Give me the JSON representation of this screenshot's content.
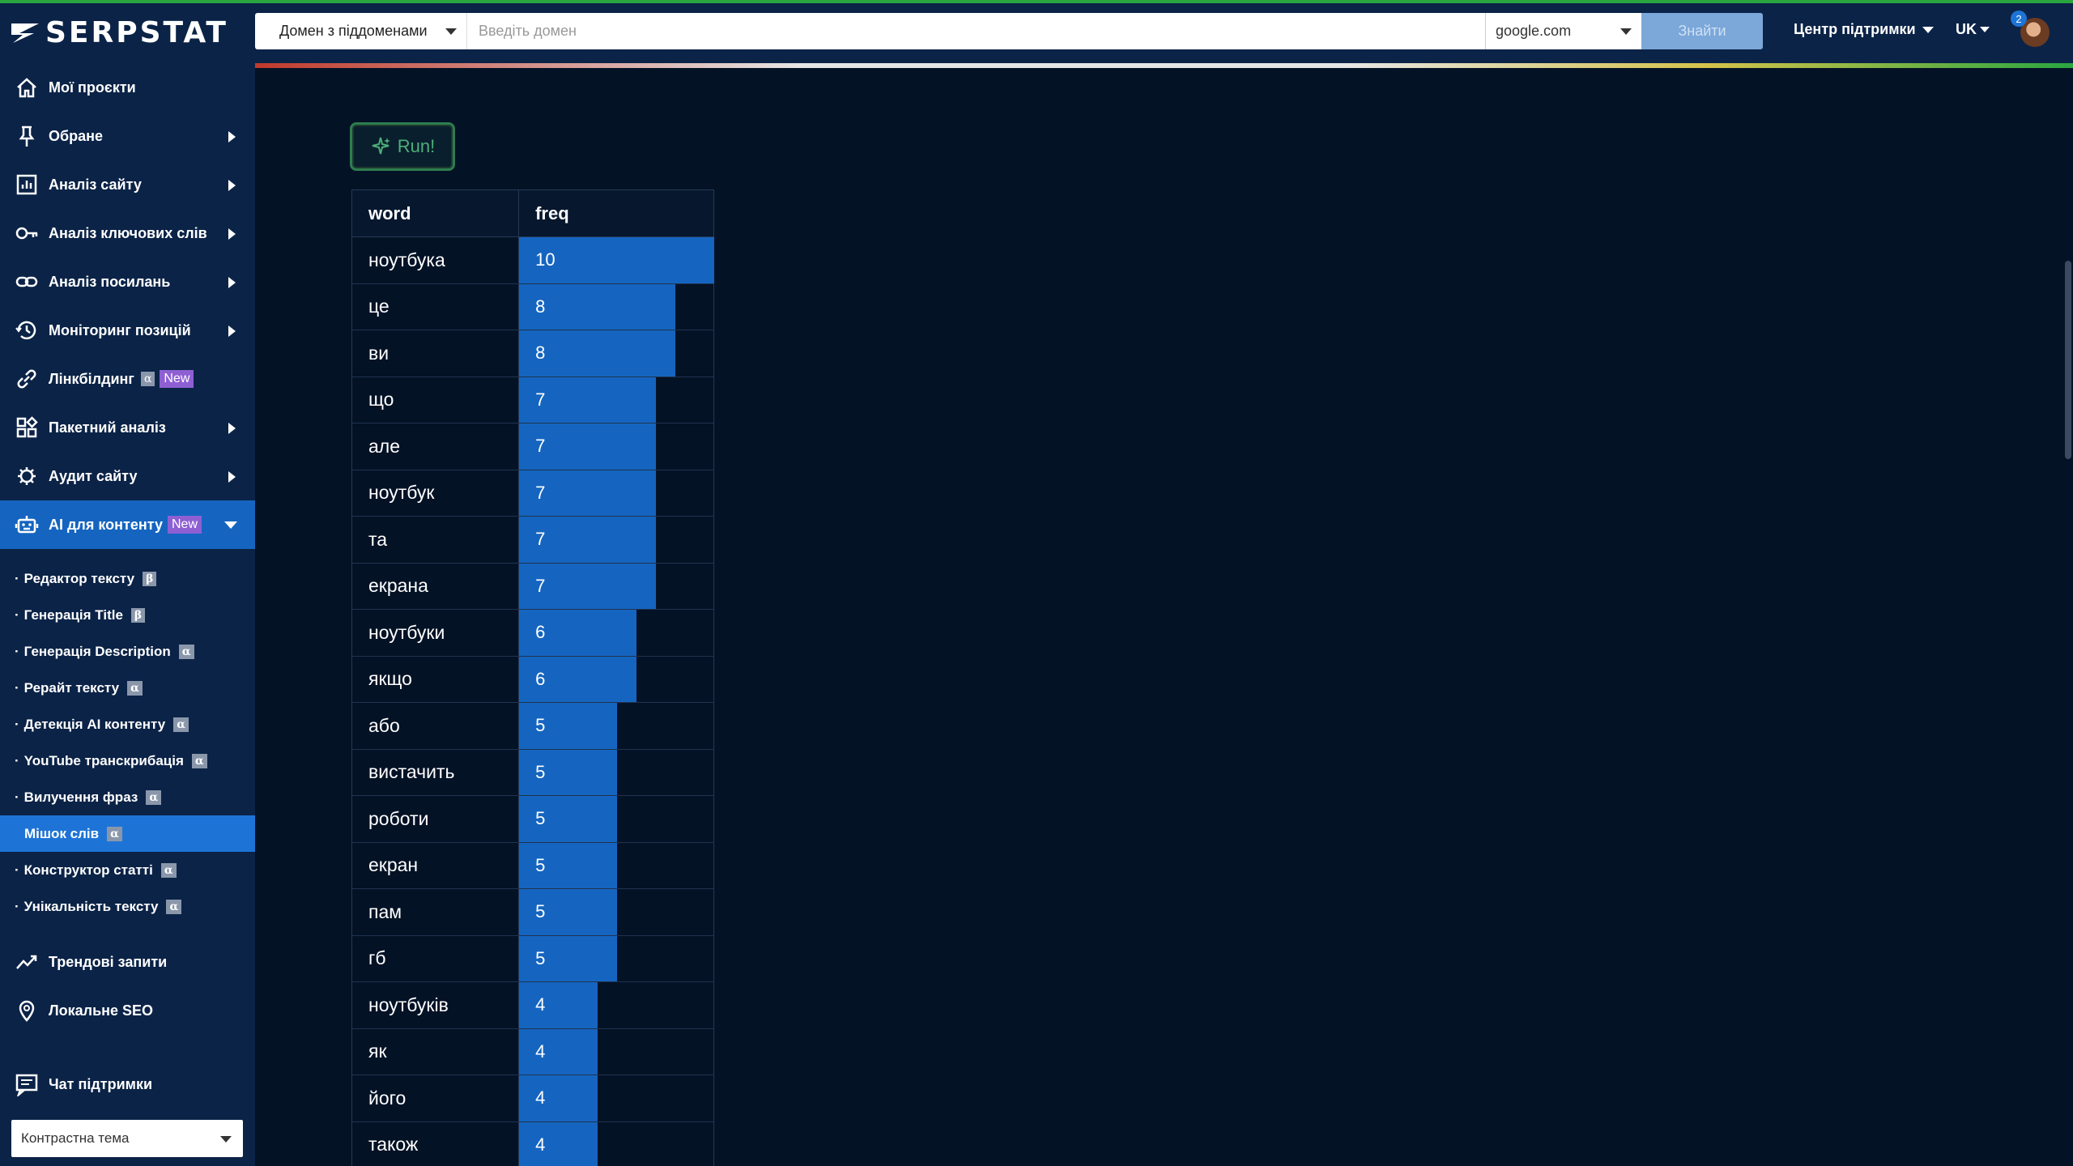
{
  "brand": {
    "name": "SERPSTAT"
  },
  "sidebar": {
    "items": [
      {
        "label": "Мої проєкти",
        "icon": "home-icon",
        "arrow": false
      },
      {
        "label": "Обране",
        "icon": "pin-icon",
        "arrow": true
      },
      {
        "label": "Аналіз сайту",
        "icon": "site-analysis-icon",
        "arrow": true
      },
      {
        "label": "Аналіз ключових слів",
        "icon": "key-icon",
        "arrow": true
      },
      {
        "label": "Аналіз посилань",
        "icon": "link-icon",
        "arrow": true
      },
      {
        "label": "Моніторинг позицій",
        "icon": "history-icon",
        "arrow": true
      },
      {
        "label": "Лінкбілдинг",
        "icon": "chain-icon",
        "alpha": "α",
        "new": "New"
      },
      {
        "label": "Пакетний аналіз",
        "icon": "grid-icon",
        "arrow": true
      },
      {
        "label": "Аудит сайту",
        "icon": "bug-icon",
        "arrow": true
      },
      {
        "label": "AI для контенту",
        "icon": "robot-icon",
        "new": "New",
        "expanded": true
      }
    ],
    "sub_items": [
      {
        "label": "Редактор тексту",
        "badge": "β"
      },
      {
        "label": "Генерація Title",
        "badge": "β"
      },
      {
        "label": "Генерація Description",
        "badge": "α"
      },
      {
        "label": "Рерайт тексту",
        "badge": "α"
      },
      {
        "label": "Детекція AI контенту",
        "badge": "α"
      },
      {
        "label": "YouTube транскрибація",
        "badge": "α"
      },
      {
        "label": "Вилучення фраз",
        "badge": "α"
      },
      {
        "label": "Мішок слів",
        "badge": "α",
        "active": true
      },
      {
        "label": "Конструктор статті",
        "badge": "α"
      },
      {
        "label": "Унікальність тексту",
        "badge": "α"
      }
    ],
    "bottom_items": [
      {
        "label": "Трендові запити",
        "icon": "trend-icon"
      },
      {
        "label": "Локальне SEO",
        "icon": "location-pin-icon"
      }
    ],
    "chat_label": "Чат підтримки",
    "theme_select": "Контрастна тема"
  },
  "topbar": {
    "domain_type": "Домен з піддоменами",
    "domain_placeholder": "Введіть домен",
    "engine": "google.com",
    "find_button": "Знайти",
    "support": "Центр підтримки",
    "lang": "UK",
    "notifications": "2"
  },
  "main": {
    "run_button": "Run!",
    "table": {
      "headers": {
        "word": "word",
        "freq": "freq"
      },
      "max_freq": 10,
      "rows": [
        {
          "word": "ноутбука",
          "freq": 10
        },
        {
          "word": "це",
          "freq": 8
        },
        {
          "word": "ви",
          "freq": 8
        },
        {
          "word": "що",
          "freq": 7
        },
        {
          "word": "але",
          "freq": 7
        },
        {
          "word": "ноутбук",
          "freq": 7
        },
        {
          "word": "та",
          "freq": 7
        },
        {
          "word": "екрана",
          "freq": 7
        },
        {
          "word": "ноутбуки",
          "freq": 6
        },
        {
          "word": "якщо",
          "freq": 6
        },
        {
          "word": "або",
          "freq": 5
        },
        {
          "word": "вистачить",
          "freq": 5
        },
        {
          "word": "роботи",
          "freq": 5
        },
        {
          "word": "екран",
          "freq": 5
        },
        {
          "word": "пам",
          "freq": 5
        },
        {
          "word": "гб",
          "freq": 5
        },
        {
          "word": "ноутбуків",
          "freq": 4
        },
        {
          "word": "як",
          "freq": 4
        },
        {
          "word": "його",
          "freq": 4
        },
        {
          "word": "також",
          "freq": 4
        }
      ]
    }
  },
  "colors": {
    "bar": "#1565c0",
    "sidebar": "#0b2347",
    "background": "#041226",
    "accent_green": "#2e7d4f"
  }
}
